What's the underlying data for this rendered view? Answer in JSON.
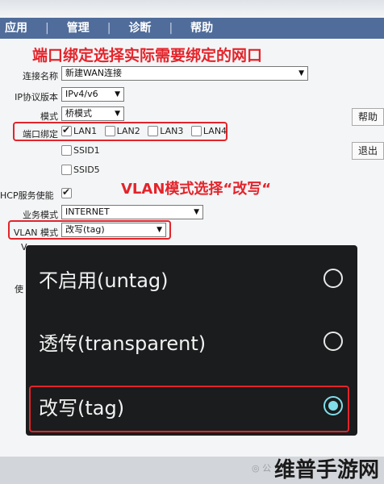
{
  "nav": {
    "items": [
      "应用",
      "管理",
      "诊断",
      "帮助"
    ]
  },
  "annotations": {
    "port_binding": "端口绑定选择实际需要绑定的网口",
    "vlan_mode": "VLAN模式选择“改写“"
  },
  "form": {
    "connection_name_label": "连接名称",
    "connection_name_value": "新建WAN连接",
    "ip_version_label": "IP协议版本",
    "ip_version_value": "IPv4/v6",
    "mode_label": "模式",
    "mode_value": "桥模式",
    "port_binding_label": "端口绑定",
    "ports": [
      {
        "label": "LAN1",
        "checked": true
      },
      {
        "label": "LAN2",
        "checked": false
      },
      {
        "label": "LAN3",
        "checked": false
      },
      {
        "label": "LAN4",
        "checked": false
      }
    ],
    "ssid1_label": "SSID1",
    "ssid5_label": "SSID5",
    "dhcp_label": "HCP服务使能",
    "service_mode_label": "业务模式",
    "service_mode_value": "INTERNET",
    "vlan_mode_label": "VLAN 模式",
    "vlan_mode_value": "改写(tag)",
    "partial_label_1": "V",
    "partial_label_2": "使"
  },
  "side_buttons": {
    "help": "帮助",
    "exit": "退出"
  },
  "vlan_options": [
    {
      "label": "不启用(untag)",
      "selected": false
    },
    {
      "label": "透传(transparent)",
      "selected": false
    },
    {
      "label": "改写(tag)",
      "selected": true
    }
  ],
  "watermark": {
    "main": "维普手游网",
    "faint": "◎ 公"
  },
  "colors": {
    "nav_bg": "#4f6c9a",
    "annotation_red": "#e3242b",
    "dialog_bg": "#1a1c1d",
    "radio_selected": "#80deea"
  }
}
